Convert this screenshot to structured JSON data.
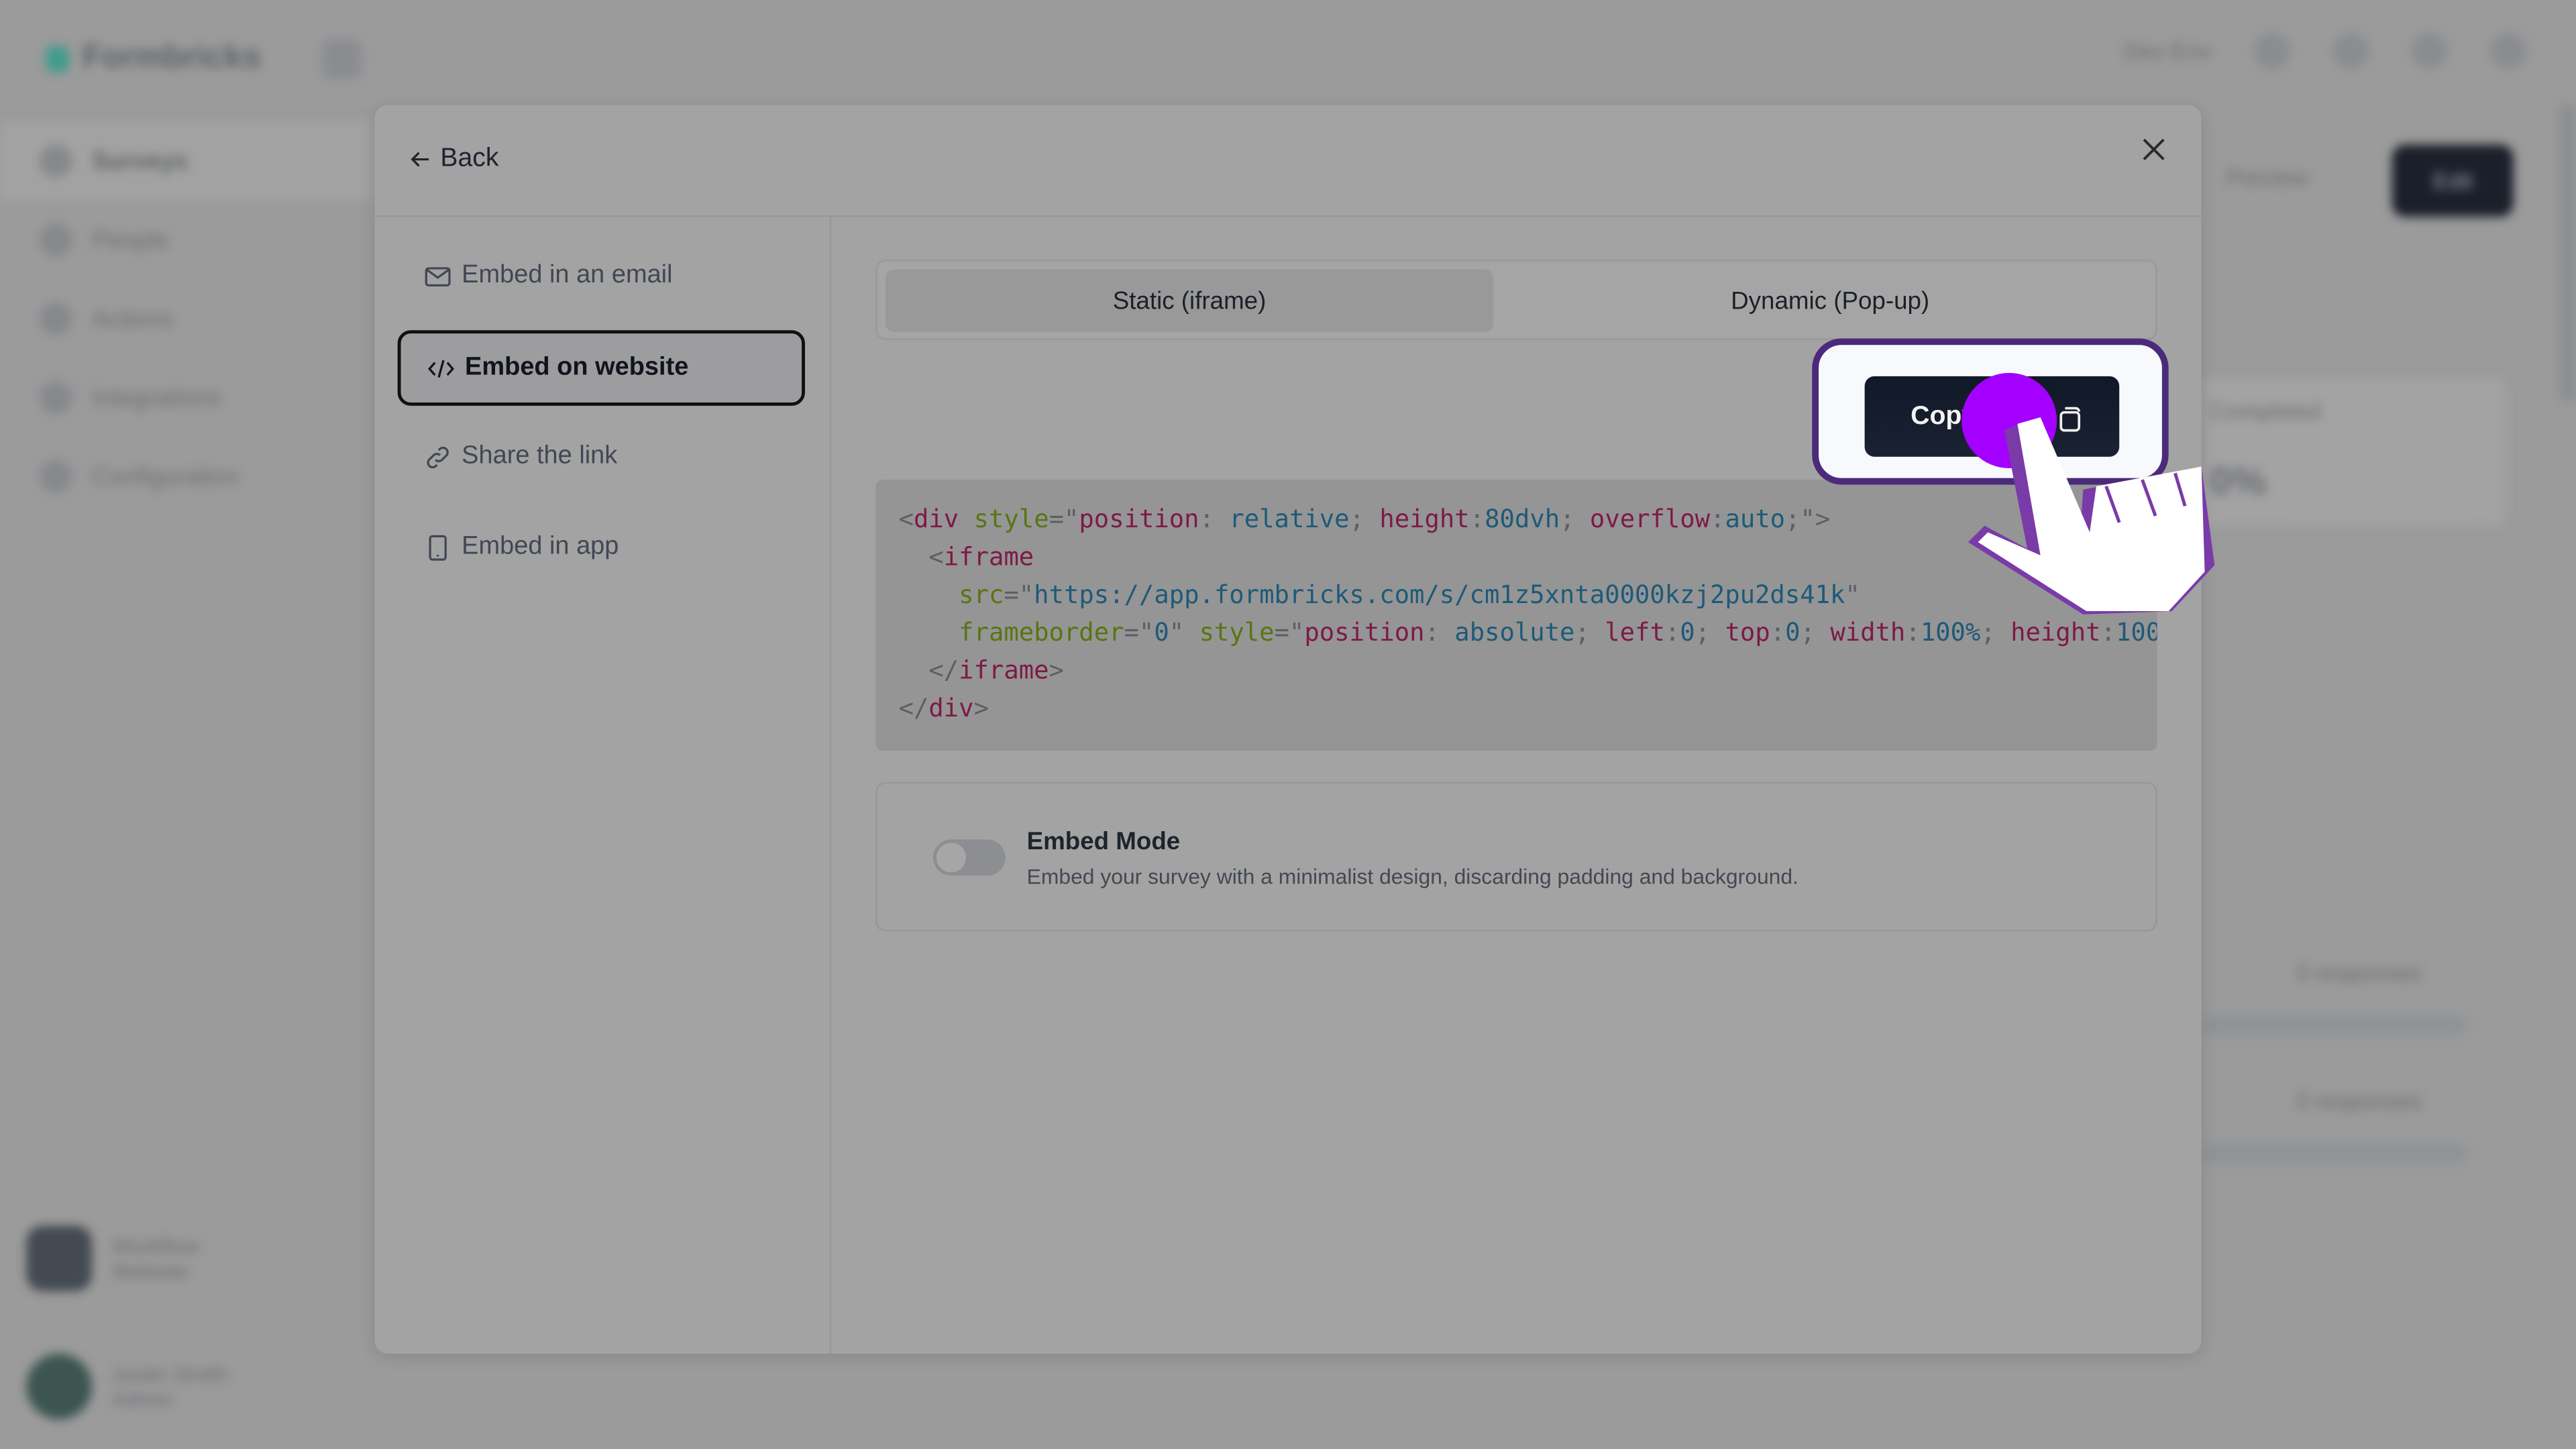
{
  "background": {
    "brand": "Formbricks",
    "sidebar": [
      "Surveys",
      "People",
      "Actions",
      "Integrations",
      "Configuration"
    ],
    "users": [
      {
        "name": "Workflow",
        "sub": "Website"
      },
      {
        "name": "Justin Smith",
        "sub": "Admin"
      }
    ],
    "top_right": "Dev Env",
    "preview_label": "Preview",
    "edit_label": "Edit",
    "stat_label": "Completed",
    "stat_value": "0%",
    "responses": [
      "0 responses",
      "0 responses"
    ]
  },
  "modal": {
    "back_label": "Back",
    "close_icon": "x-icon",
    "nav": [
      {
        "label": "Embed in an email",
        "icon": "mail-icon",
        "active": false
      },
      {
        "label": "Embed on website",
        "icon": "code-icon",
        "active": true
      },
      {
        "label": "Share the link",
        "icon": "link-icon",
        "active": false
      },
      {
        "label": "Embed in app",
        "icon": "smartphone-icon",
        "active": false
      }
    ],
    "tabs": [
      {
        "label": "Static (iframe)",
        "active": true
      },
      {
        "label": "Dynamic (Pop-up)",
        "active": false
      }
    ],
    "copy_button": {
      "label": "Copy code",
      "icon": "copy-icon"
    },
    "code_lines": [
      [
        [
          "p",
          "<"
        ],
        [
          "tag",
          "div"
        ],
        [
          "p",
          " "
        ],
        [
          "attr",
          "style"
        ],
        [
          "p",
          "=\""
        ],
        [
          "prop",
          "position"
        ],
        [
          "p",
          ": "
        ],
        [
          "val",
          "relative"
        ],
        [
          "p",
          "; "
        ],
        [
          "prop",
          "height"
        ],
        [
          "p",
          ":"
        ],
        [
          "val",
          "80dvh"
        ],
        [
          "p",
          "; "
        ],
        [
          "prop",
          "overflow"
        ],
        [
          "p",
          ":"
        ],
        [
          "val",
          "auto"
        ],
        [
          "p",
          ";\">"
        ]
      ],
      [
        [
          "p",
          "  <"
        ],
        [
          "tag",
          "iframe"
        ]
      ],
      [
        [
          "p",
          "    "
        ],
        [
          "attr",
          "src"
        ],
        [
          "p",
          "=\""
        ],
        [
          "val",
          "https://app.formbricks.com/s/cm1z5xnta0000kzj2pu2ds41k"
        ],
        [
          "p",
          "\""
        ]
      ],
      [
        [
          "p",
          "    "
        ],
        [
          "attr",
          "frameborder"
        ],
        [
          "p",
          "=\""
        ],
        [
          "val",
          "0"
        ],
        [
          "p",
          "\" "
        ],
        [
          "attr",
          "style"
        ],
        [
          "p",
          "=\""
        ],
        [
          "prop",
          "position"
        ],
        [
          "p",
          ": "
        ],
        [
          "val",
          "absolute"
        ],
        [
          "p",
          "; "
        ],
        [
          "prop",
          "left"
        ],
        [
          "p",
          ":"
        ],
        [
          "val",
          "0"
        ],
        [
          "p",
          "; "
        ],
        [
          "prop",
          "top"
        ],
        [
          "p",
          ":"
        ],
        [
          "val",
          "0"
        ],
        [
          "p",
          "; "
        ],
        [
          "prop",
          "width"
        ],
        [
          "p",
          ":"
        ],
        [
          "val",
          "100%"
        ],
        [
          "p",
          "; "
        ],
        [
          "prop",
          "height"
        ],
        [
          "p",
          ":"
        ],
        [
          "val",
          "100"
        ]
      ],
      [
        [
          "p",
          "  </"
        ],
        [
          "tag",
          "iframe"
        ],
        [
          "p",
          ">"
        ]
      ],
      [
        [
          "p",
          "</"
        ],
        [
          "tag",
          "div"
        ],
        [
          "p",
          ">"
        ]
      ]
    ],
    "embed_mode": {
      "title": "Embed Mode",
      "description": "Embed your survey with a minimalist design, discarding padding and background.",
      "enabled": false
    }
  },
  "colors": {
    "highlight_border": "#4b2a7b",
    "click_indicator": "#a300ff",
    "button_dark": "#111827"
  }
}
